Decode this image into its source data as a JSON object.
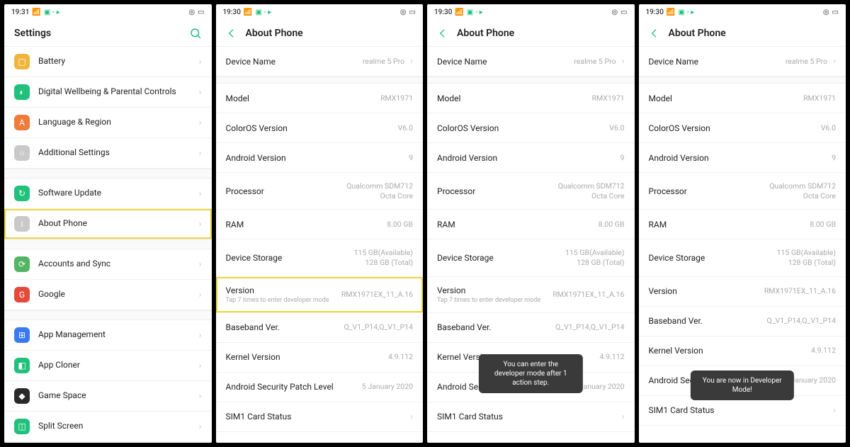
{
  "statusbar": {
    "time1": "19:31",
    "time2": "19:30",
    "icons_left": "⬚ ◦ ▸",
    "icons_right": "◎ ▢"
  },
  "settings": {
    "title": "Settings",
    "items": [
      {
        "icon_bg": "#f0b53a",
        "glyph": "▢",
        "label": "Battery"
      },
      {
        "icon_bg": "#1fc17b",
        "glyph": "◐",
        "label": "Digital Wellbeing & Parental Controls"
      },
      {
        "icon_bg": "#f07a3a",
        "glyph": "A",
        "label": "Language & Region"
      },
      {
        "icon_bg": "#c9c9c9",
        "glyph": "○",
        "label": "Additional Settings"
      }
    ],
    "items2": [
      {
        "icon_bg": "#1fc17b",
        "glyph": "↻",
        "label": "Software Update"
      },
      {
        "icon_bg": "#c9c9c9",
        "glyph": "i",
        "label": "About Phone",
        "highlight": true
      }
    ],
    "items3": [
      {
        "icon_bg": "#54b464",
        "glyph": "⟳",
        "label": "Accounts and Sync"
      },
      {
        "icon_bg": "#e44a3a",
        "glyph": "G",
        "label": "Google"
      }
    ],
    "items4": [
      {
        "icon_bg": "#3a7af0",
        "glyph": "⊞",
        "label": "App Management"
      },
      {
        "icon_bg": "#1fc17b",
        "glyph": "◧",
        "label": "App Cloner"
      },
      {
        "icon_bg": "#2a2a2a",
        "glyph": "◆",
        "label": "Game Space"
      },
      {
        "icon_bg": "#1fc17b",
        "glyph": "◫",
        "label": "Split Screen"
      }
    ]
  },
  "about": {
    "title": "About Phone",
    "rows": [
      {
        "label": "Device Name",
        "value": "realme 5 Pro",
        "chev": true
      },
      {
        "label": "Model",
        "value": "RMX1971"
      },
      {
        "label": "ColorOS Version",
        "value": "V6.0"
      },
      {
        "label": "Android Version",
        "value": "9"
      },
      {
        "label": "Processor",
        "value": "Qualcomm  SDM712\nOcta Core"
      },
      {
        "label": "RAM",
        "value": "8.00 GB"
      },
      {
        "label": "Device Storage",
        "value": "115 GB(Available)\n128 GB (Total)"
      },
      {
        "label": "Version",
        "sub": "Tap 7 times to enter developer mode",
        "value": "RMX1971EX_11_A.16"
      },
      {
        "label": "Baseband Ver.",
        "value": "Q_V1_P14,Q_V1_P14"
      },
      {
        "label": "Kernel Version",
        "value": "4.9.112"
      },
      {
        "label": "Android Security Patch Level",
        "value": "5 January 2020"
      },
      {
        "label": "SIM1 Card Status",
        "value": "",
        "chev": true
      }
    ]
  },
  "toast1": "You can enter the developer mode after 1 action step.",
  "toast2": "You are now in Developer Mode!"
}
